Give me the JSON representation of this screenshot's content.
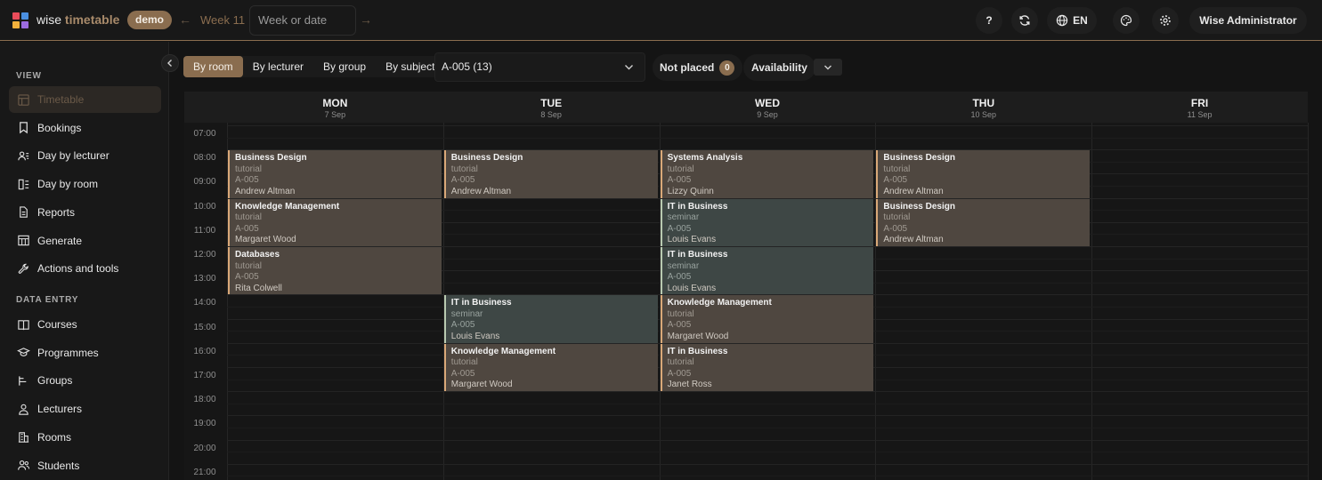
{
  "app": {
    "brand_part1": "wise",
    "brand_part2": "timetable",
    "badge": "demo",
    "logo_colors": [
      "#e94c5a",
      "#4a8fe0",
      "#f2b13c",
      "#9b6be0"
    ]
  },
  "header": {
    "week_label": "Week 11",
    "week_placeholder": "Week or date",
    "help": "?",
    "lang": "EN",
    "user": "Wise Administrator"
  },
  "sidebar": {
    "view_title": "VIEW",
    "view_items": [
      {
        "label": "Timetable",
        "icon": "grid-icon",
        "active": true
      },
      {
        "label": "Bookings",
        "icon": "bookmark-icon"
      },
      {
        "label": "Day by lecturer",
        "icon": "people-icon"
      },
      {
        "label": "Day by room",
        "icon": "room-list-icon"
      },
      {
        "label": "Reports",
        "icon": "document-icon"
      },
      {
        "label": "Generate",
        "icon": "table-icon"
      },
      {
        "label": "Actions and tools",
        "icon": "wrench-icon"
      }
    ],
    "data_title": "DATA ENTRY",
    "data_items": [
      {
        "label": "Courses",
        "icon": "book-icon"
      },
      {
        "label": "Programmes",
        "icon": "graduation-cap-icon"
      },
      {
        "label": "Groups",
        "icon": "groups-icon"
      },
      {
        "label": "Lecturers",
        "icon": "person-icon"
      },
      {
        "label": "Rooms",
        "icon": "building-icon"
      },
      {
        "label": "Students",
        "icon": "students-icon"
      }
    ]
  },
  "toolbar": {
    "tabs": [
      "By room",
      "By lecturer",
      "By group",
      "By subject"
    ],
    "active_tab": "By room",
    "room_value": "A-005 (13)",
    "not_placed_label": "Not placed",
    "not_placed_count": "0",
    "availability_label": "Availability"
  },
  "calendar": {
    "days": [
      {
        "name": "MON",
        "date": "7 Sep"
      },
      {
        "name": "TUE",
        "date": "8 Sep"
      },
      {
        "name": "WED",
        "date": "9 Sep"
      },
      {
        "name": "THU",
        "date": "10 Sep"
      },
      {
        "name": "FRI",
        "date": "11 Sep"
      }
    ],
    "hours": [
      "07:00",
      "08:00",
      "09:00",
      "10:00",
      "11:00",
      "12:00",
      "13:00",
      "14:00",
      "15:00",
      "16:00",
      "17:00",
      "18:00",
      "19:00",
      "20:00",
      "21:00"
    ],
    "events": [
      {
        "day": 0,
        "start": "08:00",
        "end": "10:00",
        "title": "Business Design",
        "kind": "tutorial",
        "room": "A-005",
        "person": "Andrew Altman"
      },
      {
        "day": 0,
        "start": "10:00",
        "end": "12:00",
        "title": "Knowledge Management",
        "kind": "tutorial",
        "room": "A-005",
        "person": "Margaret Wood"
      },
      {
        "day": 0,
        "start": "12:00",
        "end": "14:00",
        "title": "Databases",
        "kind": "tutorial",
        "room": "A-005",
        "person": "Rita Colwell"
      },
      {
        "day": 1,
        "start": "08:00",
        "end": "10:00",
        "title": "Business Design",
        "kind": "tutorial",
        "room": "A-005",
        "person": "Andrew Altman"
      },
      {
        "day": 1,
        "start": "14:00",
        "end": "16:00",
        "title": "IT in Business",
        "kind": "seminar",
        "room": "A-005",
        "person": "Louis Evans"
      },
      {
        "day": 1,
        "start": "16:00",
        "end": "18:00",
        "title": "Knowledge Management",
        "kind": "tutorial",
        "room": "A-005",
        "person": "Margaret Wood"
      },
      {
        "day": 2,
        "start": "08:00",
        "end": "10:00",
        "title": "Systems Analysis",
        "kind": "tutorial",
        "room": "A-005",
        "person": "Lizzy Quinn"
      },
      {
        "day": 2,
        "start": "10:00",
        "end": "12:00",
        "title": "IT in Business",
        "kind": "seminar",
        "room": "A-005",
        "person": "Louis Evans"
      },
      {
        "day": 2,
        "start": "12:00",
        "end": "14:00",
        "title": "IT in Business",
        "kind": "seminar",
        "room": "A-005",
        "person": "Louis Evans"
      },
      {
        "day": 2,
        "start": "14:00",
        "end": "16:00",
        "title": "Knowledge Management",
        "kind": "tutorial",
        "room": "A-005",
        "person": "Margaret Wood"
      },
      {
        "day": 2,
        "start": "16:00",
        "end": "18:00",
        "title": "IT in Business",
        "kind": "tutorial",
        "room": "A-005",
        "person": "Janet Ross"
      },
      {
        "day": 3,
        "start": "08:00",
        "end": "10:00",
        "title": "Business Design",
        "kind": "tutorial",
        "room": "A-005",
        "person": "Andrew Altman"
      },
      {
        "day": 3,
        "start": "10:00",
        "end": "12:00",
        "title": "Business Design",
        "kind": "tutorial",
        "room": "A-005",
        "person": "Andrew Altman"
      }
    ]
  }
}
